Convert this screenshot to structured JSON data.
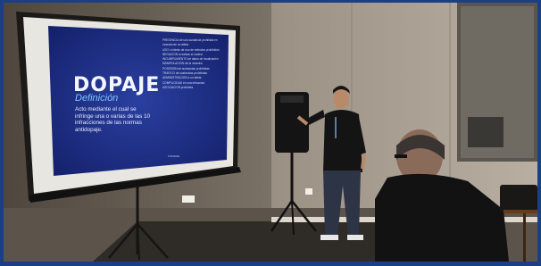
{
  "slide": {
    "title": "DOPAJE",
    "subtitle": "Definición",
    "description": "Acto mediante el cual se infringe una o varias de las 10 infracciones de las normas antidopaje.",
    "side_list": [
      "PRESENCIA de una sustancia prohibida en",
      "muestra de un atleta",
      "USO o intento de uso de métodos prohibidos",
      "NEGACIÓN a realizar el control",
      "INCUMPLIMIENTO de datos de localización",
      "MANIPULACIÓN de la muestra",
      "POSESIÓN de sustancias prohibidas",
      "TRÁFICO de sustancias prohibidas",
      "ADMINISTRACIÓN a un atleta",
      "COMPLICIDAD en una infracción",
      "ASOCIACIÓN prohibida"
    ],
    "footer": "CONADE"
  },
  "colors": {
    "border": "#1b3f86",
    "slide_bg": "#1a2a7a",
    "accent": "#7fc6ff"
  }
}
